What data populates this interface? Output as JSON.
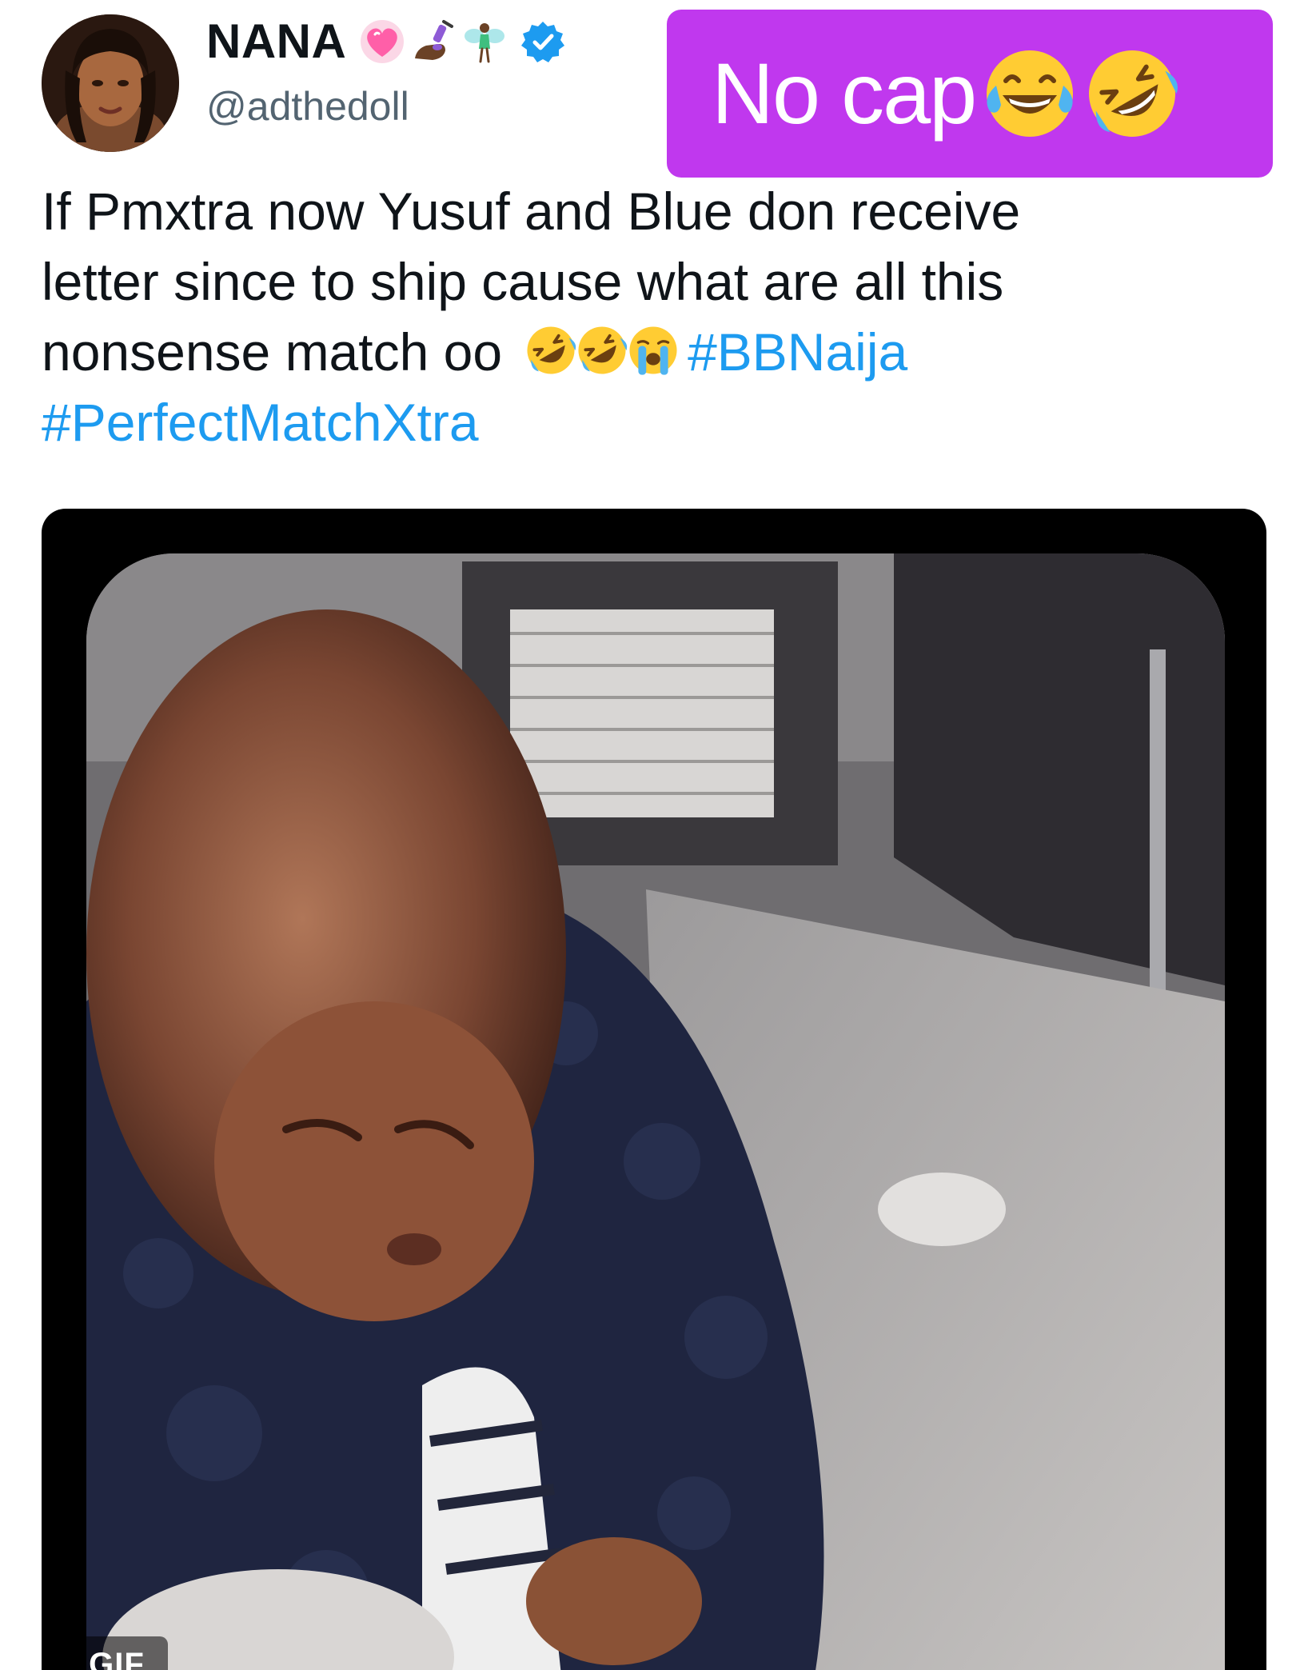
{
  "author": {
    "display_name": "NANA",
    "name_emojis": [
      "pink-heart-emoji",
      "nail-polish-emoji",
      "fairy-emoji"
    ],
    "verified": true,
    "handle": "@adthedoll"
  },
  "caption": {
    "text": "No cap",
    "emojis": [
      "tears-of-joy-emoji",
      "rolling-on-floor-laughing-emoji"
    ],
    "background_color": "#c038ee"
  },
  "tweet": {
    "lines": [
      "If Pmxtra now Yusuf and Blue don receive",
      "letter since to ship cause what are all this",
      "nonsense match oo"
    ],
    "inline_emojis": [
      "rolling-on-floor-laughing-emoji",
      "rolling-on-floor-laughing-emoji",
      "loudly-crying-emoji"
    ],
    "hashtags": [
      "#BBNaija",
      "#PerfectMatchXtra"
    ],
    "hashtag_color": "#1d9bf0"
  },
  "media": {
    "type": "gif",
    "badge": "GIF",
    "subject": "baby-in-navy-fleece-jacket"
  }
}
